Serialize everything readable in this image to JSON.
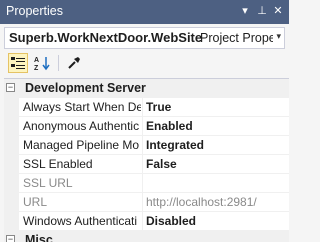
{
  "window": {
    "title": "Properties",
    "buttons": {
      "dropdown": "▾",
      "pin": "⊥",
      "close": "✕"
    }
  },
  "object_selector": {
    "name": "Superb.WorkNextDoor.WebSite",
    "type": "Project Proper",
    "arrow": "▾"
  },
  "toolbar": {
    "icons": [
      "categorized-icon",
      "alphabetical-icon",
      "property-pages-icon"
    ],
    "sort_az_label": "A",
    "sort_za_label": "Z"
  },
  "grid": {
    "categories": [
      {
        "name": "Development Server",
        "toggle": "−",
        "properties": [
          {
            "name": "Always Start When De",
            "value": "True",
            "bold": true,
            "dim": false
          },
          {
            "name": "Anonymous Authentic",
            "value": "Enabled",
            "bold": true,
            "dim": false
          },
          {
            "name": "Managed Pipeline Mo",
            "value": "Integrated",
            "bold": true,
            "dim": false
          },
          {
            "name": "SSL Enabled",
            "value": "False",
            "bold": true,
            "dim": false
          },
          {
            "name": "SSL URL",
            "value": "",
            "bold": false,
            "dim": true
          },
          {
            "name": "URL",
            "value": "http://localhost:2981/",
            "bold": false,
            "dim": true
          },
          {
            "name": "Windows Authenticati",
            "value": "Disabled",
            "bold": true,
            "dim": false
          }
        ]
      },
      {
        "name": "Misc",
        "toggle": "−",
        "properties": []
      }
    ]
  },
  "colors": {
    "titlebar": "#4d6082",
    "window_bg": "#f5f5f5",
    "gutter": "#f0f0f0",
    "dim_text": "#8a8a8a"
  }
}
